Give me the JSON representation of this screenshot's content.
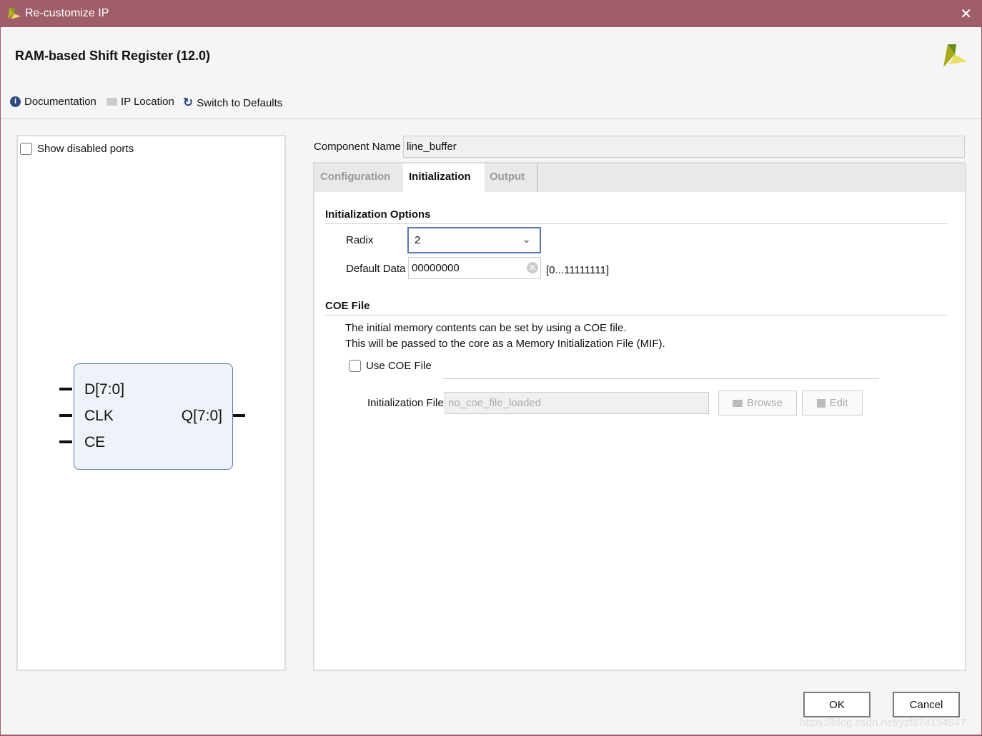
{
  "window": {
    "title": "Re-customize IP",
    "close": "✕"
  },
  "header": {
    "title": "RAM-based Shift Register (12.0)"
  },
  "toolbar": {
    "documentation": "Documentation",
    "ip_location": "IP Location",
    "switch_defaults": "Switch to Defaults"
  },
  "left": {
    "show_disabled_ports": "Show disabled ports",
    "block": {
      "inputs": [
        "D[7:0]",
        "CLK",
        "CE"
      ],
      "output": "Q[7:0]"
    }
  },
  "component": {
    "label": "Component Name",
    "value": "line_buffer"
  },
  "tabs": [
    {
      "label": "Configuration",
      "active": false
    },
    {
      "label": "Initialization",
      "active": true
    },
    {
      "label": "Output",
      "active": false
    }
  ],
  "init": {
    "section": "Initialization Options",
    "radix_label": "Radix",
    "radix_value": "2",
    "default_label": "Default Data",
    "default_value": "00000000",
    "range": "[0...11111111]"
  },
  "coe": {
    "section": "COE File",
    "desc1": "The initial memory contents can be set by using a COE file.",
    "desc2": "This will be passed to the core as a Memory Initialization File (MIF).",
    "use_coe": "Use COE File",
    "file_label": "Initialization File",
    "file_placeholder": "no_coe_file_loaded",
    "browse": "Browse",
    "edit": "Edit"
  },
  "footer": {
    "ok": "OK",
    "cancel": "Cancel",
    "watermark": "https://blog.csdn.net/yzf874154547"
  },
  "colors": {
    "titlebar": "#9e5d69",
    "accent": "#5a79b5"
  }
}
